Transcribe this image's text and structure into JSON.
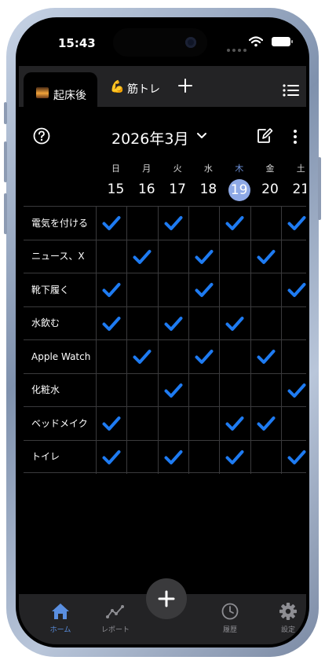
{
  "status": {
    "time": "15:43"
  },
  "tabs": [
    {
      "label": "起床後",
      "active": true
    },
    {
      "label": "筋トレ",
      "emoji": "💪"
    }
  ],
  "header": {
    "month_label": "2026年3月"
  },
  "week": {
    "dows": [
      "日",
      "月",
      "火",
      "水",
      "木",
      "金",
      "土"
    ],
    "days": [
      "15",
      "16",
      "17",
      "18",
      "19",
      "20",
      "21"
    ],
    "today_index": 4
  },
  "habits": [
    {
      "name": "電気を付ける",
      "checks": [
        1,
        0,
        1,
        0,
        1,
        0,
        1
      ]
    },
    {
      "name": "ニュース、X",
      "checks": [
        0,
        1,
        0,
        1,
        0,
        1,
        0
      ]
    },
    {
      "name": "靴下履く",
      "checks": [
        1,
        0,
        0,
        1,
        0,
        0,
        1
      ]
    },
    {
      "name": "水飲む",
      "checks": [
        1,
        0,
        1,
        0,
        1,
        0,
        0
      ]
    },
    {
      "name": "Apple Watch",
      "checks": [
        0,
        1,
        0,
        1,
        0,
        1,
        0
      ]
    },
    {
      "name": "化粧水",
      "checks": [
        0,
        0,
        1,
        0,
        0,
        0,
        1
      ]
    },
    {
      "name": "ベッドメイク",
      "checks": [
        1,
        0,
        0,
        0,
        1,
        1,
        0
      ]
    },
    {
      "name": "トイレ",
      "checks": [
        1,
        0,
        1,
        0,
        1,
        0,
        1
      ]
    }
  ],
  "nav": {
    "home": "ホーム",
    "report": "レポート",
    "history": "履歴",
    "settings": "設定"
  },
  "colors": {
    "accent": "#1e7bf2",
    "today": "#8ea9e6",
    "active_nav": "#5a8fe0"
  }
}
